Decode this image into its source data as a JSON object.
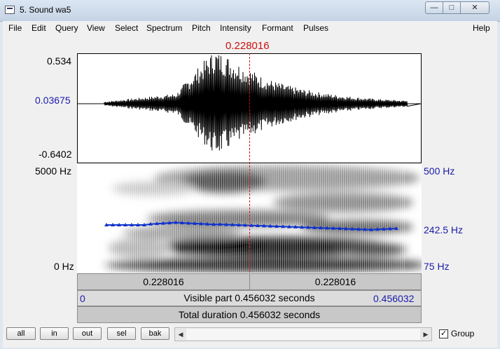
{
  "window": {
    "title": "5. Sound wa5",
    "minimize_icon": "minimize-icon",
    "maximize_icon": "maximize-icon",
    "close_icon": "close-icon"
  },
  "menu": [
    "File",
    "Edit",
    "Query",
    "View",
    "Select",
    "Spectrum",
    "Pitch",
    "Intensity",
    "Formant",
    "Pulses"
  ],
  "help_label": "Help",
  "waveform": {
    "cursor_time": "0.228016",
    "y_max": "0.534",
    "y_mid": "0.03675",
    "y_min": "-0.6402"
  },
  "spectrogram": {
    "freq_top": "5000 Hz",
    "freq_bottom": "0 Hz",
    "pitch_top": "500 Hz",
    "pitch_mid": "242.5 Hz",
    "pitch_bottom": "75 Hz"
  },
  "time_bars": {
    "left_segment": "0.228016",
    "right_segment": "0.228016",
    "visible_start": "0",
    "visible_text": "Visible part 0.456032 seconds",
    "visible_end": "0.456032",
    "total_text": "Total duration 0.456032 seconds"
  },
  "buttons": {
    "all": "all",
    "in": "in",
    "out": "out",
    "sel": "sel",
    "bak": "bak"
  },
  "group": {
    "label": "Group",
    "checked": true,
    "check_mark": "✓"
  },
  "colors": {
    "cursor": "#cc1111",
    "axis_blue": "#1a1aaa",
    "pitch": "#1133cc"
  }
}
